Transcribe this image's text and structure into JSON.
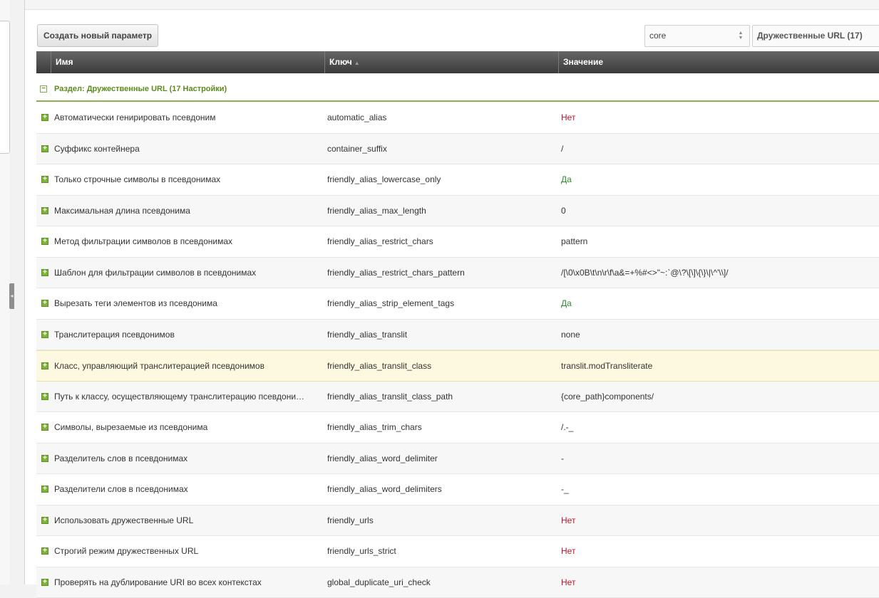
{
  "toolbar": {
    "create_label": "Создать новый параметр",
    "namespace_value": "core",
    "area_value": "Дружественные URL (17)"
  },
  "grid": {
    "columns": {
      "name": "Имя",
      "key": "Ключ",
      "value": "Значение"
    },
    "group_label": "Раздел: Дружественные URL (17 Настройки)",
    "rows": [
      {
        "name": "Автоматически генирировать псевдоним",
        "key": "automatic_alias",
        "value": "Нет",
        "value_type": "no"
      },
      {
        "name": "Суффикс контейнера",
        "key": "container_suffix",
        "value": "/",
        "value_type": "plain"
      },
      {
        "name": "Только строчные символы в псевдонимах",
        "key": "friendly_alias_lowercase_only",
        "value": "Да",
        "value_type": "yes"
      },
      {
        "name": "Максимальная длина псевдонима",
        "key": "friendly_alias_max_length",
        "value": "0",
        "value_type": "plain"
      },
      {
        "name": "Метод фильтрации символов в псевдонимах",
        "key": "friendly_alias_restrict_chars",
        "value": "pattern",
        "value_type": "plain"
      },
      {
        "name": "Шаблон для фильтрации символов в псевдонимах",
        "key": "friendly_alias_restrict_chars_pattern",
        "value": "/[\\0\\x0B\\t\\n\\r\\f\\a&=+%#<>\"~:`@\\?\\[\\]\\{\\}\\|\\^'\\\\]/",
        "value_type": "plain"
      },
      {
        "name": "Вырезать теги элементов из псевдонима",
        "key": "friendly_alias_strip_element_tags",
        "value": "Да",
        "value_type": "yes"
      },
      {
        "name": "Транслитерация псевдонимов",
        "key": "friendly_alias_translit",
        "value": "none",
        "value_type": "plain"
      },
      {
        "name": "Класс, управляющий транслитерацией псевдонимов",
        "key": "friendly_alias_translit_class",
        "value": "translit.modTransliterate",
        "value_type": "plain"
      },
      {
        "name": "Путь к классу, осуществляющему транслитерацию псевдонимов",
        "key": "friendly_alias_translit_class_path",
        "value": "{core_path}components/",
        "value_type": "plain"
      },
      {
        "name": "Символы, вырезаемые из псевдонима",
        "key": "friendly_alias_trim_chars",
        "value": "/.-_",
        "value_type": "plain"
      },
      {
        "name": "Разделитель слов в псевдонимах",
        "key": "friendly_alias_word_delimiter",
        "value": "-",
        "value_type": "plain"
      },
      {
        "name": "Разделители слов в псевдонимах",
        "key": "friendly_alias_word_delimiters",
        "value": "-_",
        "value_type": "plain"
      },
      {
        "name": "Использовать дружественные URL",
        "key": "friendly_urls",
        "value": "Нет",
        "value_type": "no"
      },
      {
        "name": "Строгий режим дружественных URL",
        "key": "friendly_urls_strict",
        "value": "Нет",
        "value_type": "no"
      },
      {
        "name": "Проверять на дублирование URI во всех контекстах",
        "key": "global_duplicate_uri_check",
        "value": "Нет",
        "value_type": "no"
      }
    ]
  },
  "state": {
    "hovered_row": 8
  },
  "colors": {
    "no": "#c0162d",
    "yes": "#2f8a2f",
    "group": "#5c8a1d",
    "header": "#4a4a4a"
  },
  "icons": {
    "expander": "plus-icon",
    "group_toggle": "minus-icon",
    "collapse": "chevron-left-icon"
  }
}
